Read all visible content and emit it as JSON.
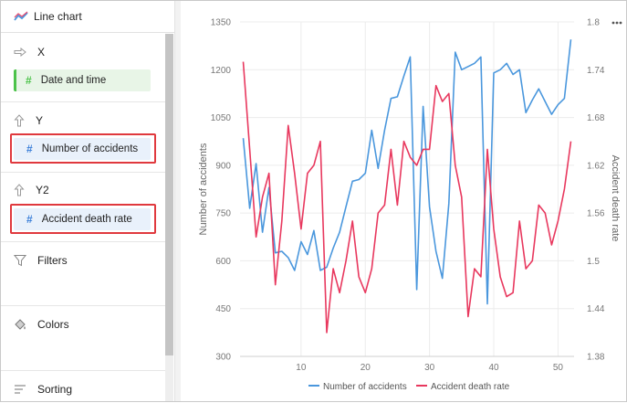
{
  "panel": {
    "title": "Line chart",
    "sections": {
      "x": {
        "label": "X",
        "field": "Date and time"
      },
      "y": {
        "label": "Y",
        "field": "Number of accidents"
      },
      "y2": {
        "label": "Y2",
        "field": "Accident death rate"
      },
      "filters": {
        "label": "Filters"
      },
      "colors": {
        "label": "Colors"
      },
      "sorting": {
        "label": "Sorting"
      }
    }
  },
  "colors": {
    "series_left": "#4a97dd",
    "series_right": "#e8385e",
    "highlight": "#e0393e",
    "x_chip": "#4cc34a"
  },
  "chart_data": {
    "type": "line",
    "x": [
      1,
      2,
      3,
      4,
      5,
      6,
      7,
      8,
      9,
      10,
      11,
      12,
      13,
      14,
      15,
      16,
      17,
      18,
      19,
      20,
      21,
      22,
      23,
      24,
      25,
      26,
      27,
      28,
      29,
      30,
      31,
      32,
      33,
      34,
      35,
      36,
      37,
      38,
      39,
      40,
      41,
      42,
      43,
      44,
      45,
      46,
      47,
      48,
      49,
      50,
      51,
      52
    ],
    "xticks": [
      10,
      20,
      30,
      40,
      50
    ],
    "xlim": [
      0.5,
      52.5
    ],
    "series": [
      {
        "name": "Number of accidents",
        "axis": "left",
        "values": [
          985,
          765,
          905,
          690,
          830,
          625,
          630,
          610,
          570,
          660,
          620,
          695,
          570,
          580,
          640,
          690,
          770,
          850,
          855,
          875,
          1010,
          890,
          1010,
          1110,
          1115,
          1180,
          1240,
          510,
          1085,
          770,
          630,
          545,
          780,
          1255,
          1200,
          1210,
          1220,
          1240,
          465,
          1190,
          1200,
          1220,
          1185,
          1200,
          1065,
          1105,
          1140,
          1100,
          1060,
          1090,
          1110,
          1295
        ]
      },
      {
        "name": "Accident death rate",
        "axis": "right",
        "values": [
          1.75,
          1.64,
          1.53,
          1.58,
          1.61,
          1.47,
          1.55,
          1.67,
          1.61,
          1.54,
          1.61,
          1.62,
          1.65,
          1.41,
          1.49,
          1.46,
          1.5,
          1.55,
          1.48,
          1.46,
          1.49,
          1.56,
          1.57,
          1.64,
          1.57,
          1.65,
          1.63,
          1.62,
          1.64,
          1.64,
          1.72,
          1.7,
          1.71,
          1.62,
          1.58,
          1.43,
          1.49,
          1.48,
          1.64,
          1.54,
          1.48,
          1.455,
          1.46,
          1.55,
          1.49,
          1.5,
          1.57,
          1.56,
          1.52,
          1.55,
          1.59,
          1.65
        ]
      }
    ],
    "y_left": {
      "label": "Number of accidents",
      "ticks": [
        300,
        450,
        600,
        750,
        900,
        1050,
        1200,
        1350
      ],
      "ylim": [
        300,
        1350
      ]
    },
    "y_right": {
      "label": "Accident death rate",
      "ticks": [
        1.38,
        1.44,
        1.5,
        1.56,
        1.62,
        1.68,
        1.74,
        1.8
      ],
      "ylim": [
        1.38,
        1.8
      ]
    },
    "grid": true,
    "legend_position": "bottom"
  }
}
